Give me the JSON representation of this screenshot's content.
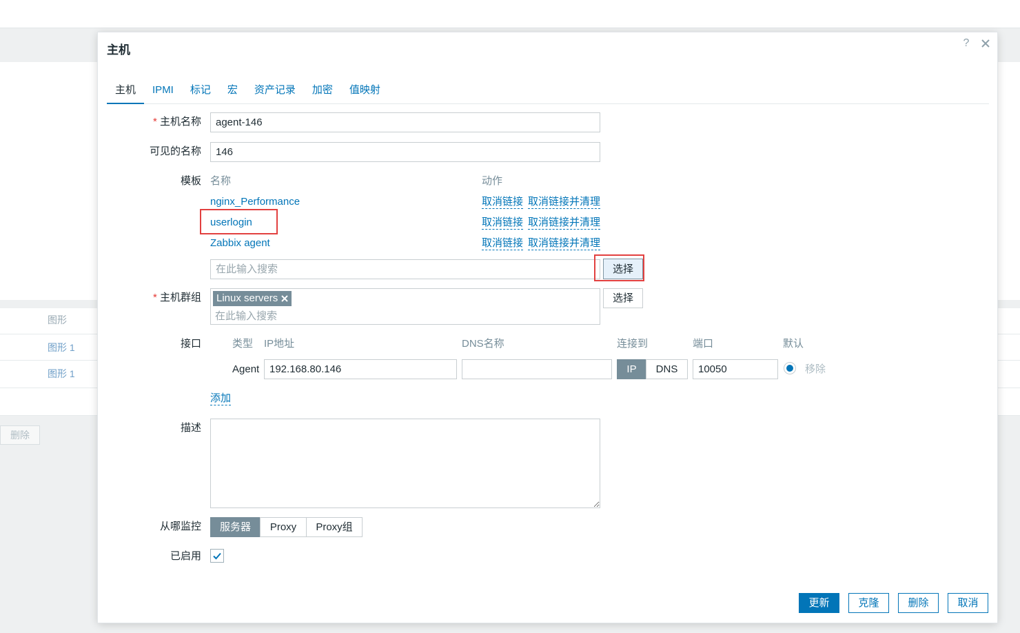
{
  "modal": {
    "title": "主机",
    "icons": {
      "help": "question-mark-icon",
      "close": "close-icon"
    }
  },
  "tabs": [
    {
      "label": "主机",
      "active": true
    },
    {
      "label": "IPMI",
      "active": false
    },
    {
      "label": "标记",
      "active": false
    },
    {
      "label": "宏",
      "active": false
    },
    {
      "label": "资产记录",
      "active": false
    },
    {
      "label": "加密",
      "active": false
    },
    {
      "label": "值映射",
      "active": false
    }
  ],
  "form": {
    "host_name": {
      "label": "主机名称",
      "required": true,
      "value": "agent-146"
    },
    "visible_name": {
      "label": "可见的名称",
      "value": "146"
    },
    "templates": {
      "label": "模板",
      "col_name": "名称",
      "col_action": "动作",
      "items": [
        {
          "name": "nginx_Performance",
          "unlink": "取消链接",
          "unlink_clear": "取消链接并清理"
        },
        {
          "name": "userlogin",
          "unlink": "取消链接",
          "unlink_clear": "取消链接并清理",
          "highlighted": true
        },
        {
          "name": "Zabbix agent",
          "unlink": "取消链接",
          "unlink_clear": "取消链接并清理"
        }
      ],
      "search_placeholder": "在此输入搜索",
      "select_label": "选择",
      "select_highlighted": true
    },
    "host_groups": {
      "label": "主机群组",
      "required": true,
      "tags": [
        "Linux servers"
      ],
      "search_placeholder": "在此输入搜索",
      "select_label": "选择"
    },
    "interfaces": {
      "label": "接口",
      "headers": {
        "type": "类型",
        "ip": "IP地址",
        "dns": "DNS名称",
        "connect_to": "连接到",
        "port": "端口",
        "default": "默认"
      },
      "rows": [
        {
          "type": "Agent",
          "ip": "192.168.80.146",
          "dns": "",
          "connect_options": [
            {
              "label": "IP",
              "active": true
            },
            {
              "label": "DNS",
              "active": false
            }
          ],
          "port": "10050",
          "is_default": true,
          "remove": "移除"
        }
      ],
      "add_label": "添加"
    },
    "description": {
      "label": "描述",
      "value": ""
    },
    "monitored_by": {
      "label": "从哪监控",
      "options": [
        {
          "label": "服务器",
          "active": true
        },
        {
          "label": "Proxy",
          "active": false
        },
        {
          "label": "Proxy组",
          "active": false
        }
      ]
    },
    "enabled": {
      "label": "已启用",
      "checked": true
    }
  },
  "footer": {
    "update": "更新",
    "clone": "克隆",
    "delete": "删除",
    "cancel": "取消"
  },
  "background": {
    "graphs_header": "图形",
    "rows": [
      "图形 1",
      "图形 1"
    ],
    "delete_button": "删除"
  },
  "colors": {
    "accent": "#0275b8",
    "text": "#1f2c33",
    "muted": "#768d99",
    "required": "#e53935",
    "annotation": "#e2403f"
  }
}
